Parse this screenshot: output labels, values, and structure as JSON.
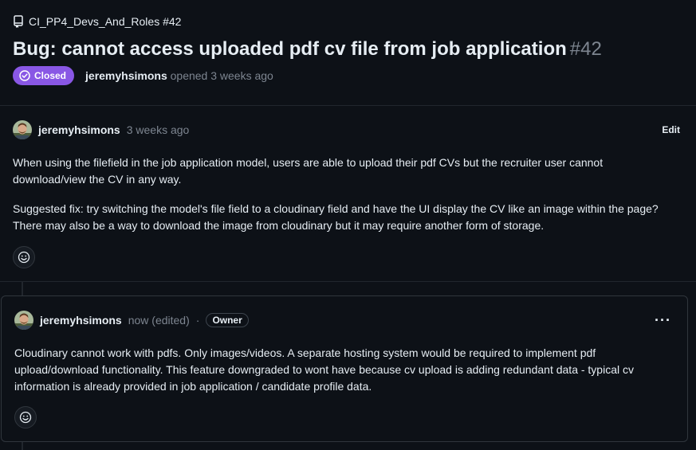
{
  "header": {
    "repo_ref": "CI_PP4_Devs_And_Roles #42",
    "title": "Bug: cannot access uploaded pdf cv file from job application",
    "number": "#42",
    "state": "Closed",
    "author": "jeremyhsimons",
    "opened_text": "opened 3 weeks ago"
  },
  "comments": [
    {
      "author": "jeremyhsimons",
      "time": "3 weeks ago",
      "edit_label": "Edit",
      "paragraphs": [
        "When using the filefield in the job application model, users are able to upload their pdf CVs but the recruiter user cannot download/view the CV in any way.",
        "Suggested fix: try switching the model's file field to a cloudinary field and have the UI display the CV like an image within the page? There may also be a way to download the image from cloudinary but it may require another form of storage."
      ]
    },
    {
      "author": "jeremyhsimons",
      "time": "now (edited)",
      "separator": "·",
      "role_badge": "Owner",
      "menu_label": "···",
      "paragraphs": [
        "Cloudinary cannot work with pdfs. Only images/videos. A separate hosting system would be required to implement pdf upload/download functionality. This feature downgraded to wont have because cv upload is adding redundant data - typical cv information is already provided in job application / candidate profile data."
      ]
    }
  ],
  "colors": {
    "background": "#0d1117",
    "closed_badge": "#8957e5",
    "muted_text": "#7d8590",
    "border": "#30363d"
  },
  "icons": {
    "repo": "repo-icon",
    "closed_state": "check-circle-icon",
    "reaction": "smiley-icon",
    "menu": "kebab-icon"
  }
}
